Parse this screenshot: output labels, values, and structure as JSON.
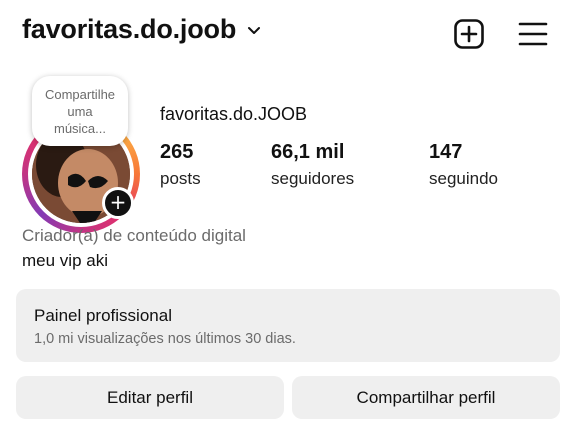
{
  "header": {
    "username": "favoritas.do.joob",
    "icons": [
      "chevron-down-icon",
      "plus-square-icon",
      "hamburger-menu-icon"
    ]
  },
  "profile": {
    "note": "Compartilhe uma música...",
    "display_name": "favoritas.do.JOOB",
    "stats": {
      "posts": {
        "value": "265",
        "label": "posts"
      },
      "followers": {
        "value": "66,1 mil",
        "label": "seguidores"
      },
      "following": {
        "value": "147",
        "label": "seguindo"
      }
    },
    "category": "Criador(a) de conteúdo digital",
    "bio": "meu vip aki"
  },
  "panel": {
    "title": "Painel profissional",
    "subtitle": "1,0 mi visualizações nos últimos 30 dias."
  },
  "buttons": {
    "edit": "Editar perfil",
    "share": "Compartilhar perfil"
  },
  "colors": {
    "story_ring": [
      "#f56040",
      "#fcaf45",
      "#e1306c",
      "#833ab4"
    ],
    "panel_bg": "#efefef",
    "muted_text": "#6b6b6b"
  }
}
